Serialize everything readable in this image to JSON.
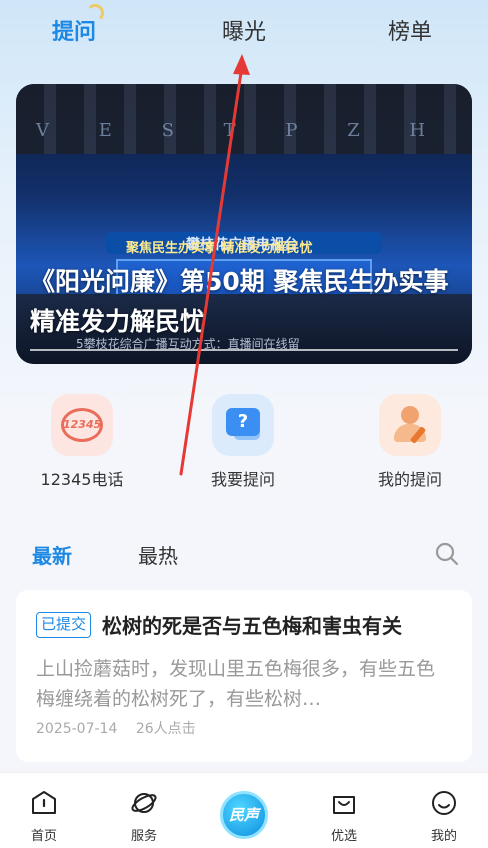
{
  "top_tabs": {
    "ask": "提问",
    "expose": "曝光",
    "rank": "榜单",
    "active": "ask"
  },
  "banner": {
    "title": "《阳光问廉》第50期 聚焦民生办实事 精准发力解民忧",
    "stage_letters": "V E S T P Z H",
    "stage_sign": "攀枝花广播电视台",
    "stage_screen": "聚焦民生办实事 精准发力解民忧",
    "stage_ticker": "5攀枝花综合广播互动方式：直播间在线留"
  },
  "actions": [
    {
      "label": "12345电话",
      "icon": "phone-12345-icon"
    },
    {
      "label": "我要提问",
      "icon": "question-chat-icon"
    },
    {
      "label": "我的提问",
      "icon": "user-edit-icon"
    }
  ],
  "list_tabs": {
    "latest": "最新",
    "hot": "最热",
    "active": "latest"
  },
  "card": {
    "badge": "已提交",
    "title": "松树的死是否与五色梅和害虫有关",
    "body": "上山捡蘑菇时，发现山里五色梅很多，有些五色梅缠绕着的松树死了，有些松树…",
    "date": "2025-07-14",
    "clicks": "26人点击"
  },
  "bottom_nav": {
    "home": "首页",
    "service": "服务",
    "center": "民声",
    "select": "优选",
    "mine": "我的"
  },
  "colors": {
    "accent": "#1e88e5",
    "annotation_arrow": "#e53935"
  }
}
